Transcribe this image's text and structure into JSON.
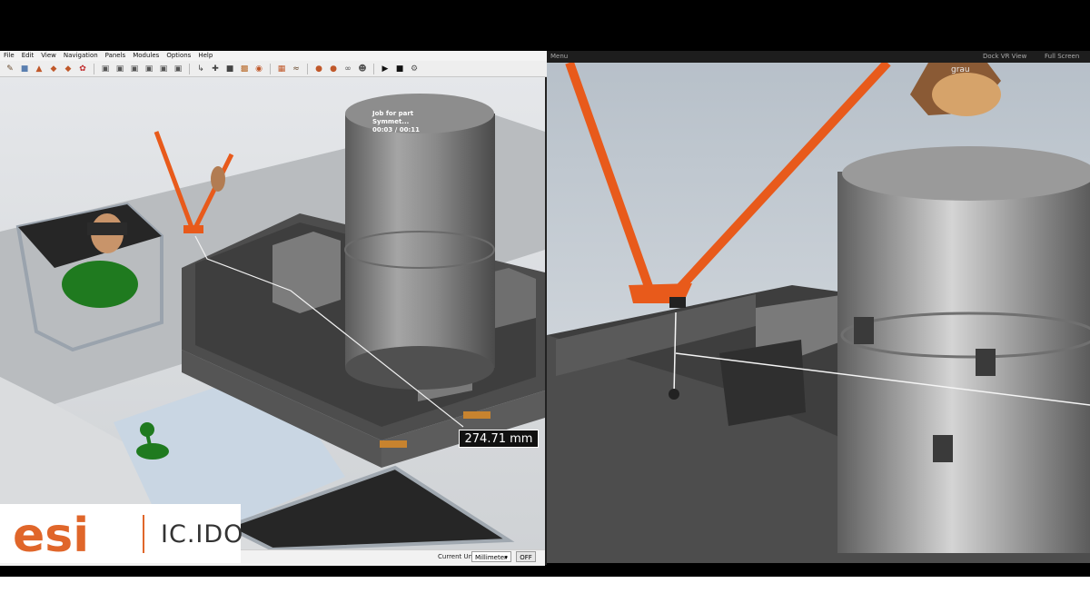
{
  "app": {
    "menu": [
      "File",
      "Edit",
      "View",
      "Navigation",
      "Panels",
      "Modules",
      "Options",
      "Help"
    ],
    "viewport": {
      "job_title": "Job for part",
      "job_subtitle": "Symmet...",
      "job_time": "00:03 / 00:11",
      "measurement": "274.71 mm"
    },
    "status": {
      "unit_label": "Current Unit:",
      "unit_value": "Millimeter",
      "toggle_label": "OFF"
    }
  },
  "logo": {
    "brand": "esi",
    "product": "IC.IDO"
  },
  "vr": {
    "menu_label": "Menu",
    "dock_label": "Dock VR View",
    "fullscreen_label": "Full Screen",
    "glove_text": "grau"
  },
  "colors": {
    "orange": "#e85a1b",
    "dark_gray": "#4a4a4a",
    "green": "#1f7a1f"
  }
}
